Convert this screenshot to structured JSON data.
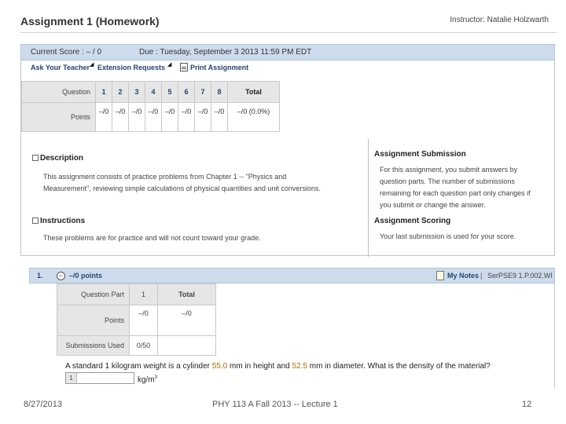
{
  "header": {
    "title": "Assignment 1 (Homework)",
    "instructor": "Instructor: Natalie Holzwarth"
  },
  "scorebar": {
    "current_score": "Current Score : – / 0",
    "due": "Due : Tuesday, September 3 2013 11:59 PM EDT"
  },
  "links": {
    "ask_teacher": "Ask Your Teacher",
    "extension": "Extension Requests",
    "print": "Print Assignment"
  },
  "score_table": {
    "question_label": "Question",
    "points_label": "Points",
    "questions": [
      "1",
      "2",
      "3",
      "4",
      "5",
      "6",
      "7",
      "8"
    ],
    "points": [
      "–/0",
      "–/0",
      "–/0",
      "–/0",
      "–/0",
      "–/0",
      "–/0",
      "–/0"
    ],
    "total_label": "Total",
    "total_value": "–/0 (0.0%)"
  },
  "description": {
    "heading": "Description",
    "line1": "This assignment consists of practice problems from Chapter 1 -- \"Physics and",
    "line2": "Measurement\", reviewing simple calculations of physical quantities and unit conversions."
  },
  "instructions": {
    "heading": "Instructions",
    "text": "These problems are for practice and will not count toward your grade."
  },
  "submission": {
    "heading": "Assignment Submission",
    "line1": "For this assignment, you submit answers by",
    "line2": "question parts. The number of submissions",
    "line3": "remaining for each question part only changes if",
    "line4": "you submit or change the answer."
  },
  "scoring": {
    "heading": "Assignment Scoring",
    "text": "Your last submission is used for your score."
  },
  "question1": {
    "number": "1.",
    "points": "–/0 points",
    "my_notes": "My Notes",
    "separator": "|",
    "ref": "SerPSE9 1.P.002.WI",
    "part_label": "Question Part",
    "part_number": "1",
    "total_label": "Total",
    "points_label": "Points",
    "points_value": "–/0",
    "total_value": "–/0",
    "submissions_label": "Submissions Used",
    "submissions_value": "0/50",
    "text_a": "A standard 1 kilogram weight is a cylinder ",
    "height": "55.0",
    "text_b": " mm in height and ",
    "diameter": "52.5",
    "text_c": " mm in diameter. What is the density of the material?",
    "answer_number": "1",
    "answer_value": "",
    "unit": "kg/m",
    "unit_exp": "3"
  },
  "footer": {
    "date": "8/27/2013",
    "course": "PHY 113 A  Fall 2013 -- Lecture 1",
    "page": "12"
  }
}
